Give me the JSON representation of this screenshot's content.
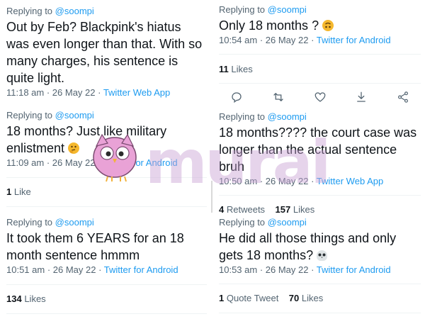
{
  "tweets": [
    {
      "reply_prefix": "Replying to",
      "reply_handle": "@soompi",
      "text": "Out by Feb? Blackpink's hiatus was even longer than that. With so many charges, his sentence is quite light.",
      "timestamp": "11:18 am · 26 May 22 · ",
      "source": "Twitter Web App"
    },
    {
      "reply_prefix": "Replying to",
      "reply_handle": "@soompi",
      "text": "Only 18 months ?",
      "timestamp": "10:54 am · 26 May 22 · ",
      "source": "Twitter for Android",
      "likes_count": "11",
      "likes_label": "Likes"
    },
    {
      "reply_prefix": "Replying to",
      "reply_handle": "@soompi",
      "text": "18 months? Just like military enlistment",
      "timestamp": "11:09 am · 26 May 22 · ",
      "source": "Twitter for Android",
      "likes_count": "1",
      "likes_label": "Like"
    },
    {
      "reply_prefix": "Replying to",
      "reply_handle": "@soompi",
      "text": "18 months???? the court case was longer than the actual sentence bruh",
      "timestamp": "10:50 am · 26 May 22 · ",
      "source": "Twitter Web App",
      "retweets_count": "4",
      "retweets_label": "Retweets",
      "likes_count": "157",
      "likes_label": "Likes"
    },
    {
      "reply_prefix": "Replying to",
      "reply_handle": "@soompi",
      "text": "It took them 6 YEARS for an 18 month sentence hmmm",
      "timestamp": "10:51 am · 26 May 22 · ",
      "source": "Twitter for Android",
      "likes_count": "134",
      "likes_label": "Likes"
    },
    {
      "reply_prefix": "Replying to",
      "reply_handle": "@soompi",
      "text": "He did all those things and only gets 18 months?",
      "timestamp": "10:53 am · 26 May 22 · ",
      "source": "Twitter for Android",
      "quotes_count": "1",
      "quotes_label": "Quote Tweet",
      "likes_count": "70",
      "likes_label": "Likes"
    }
  ],
  "watermark": "murai",
  "colors": {
    "link": "#1d9bf0",
    "muted": "#536471",
    "text": "#0f1419",
    "divider": "#eff3f4",
    "watermark": "#c8a2d4"
  },
  "icons": [
    "reply-icon",
    "retweet-icon",
    "like-icon",
    "download-icon",
    "share-icon"
  ]
}
